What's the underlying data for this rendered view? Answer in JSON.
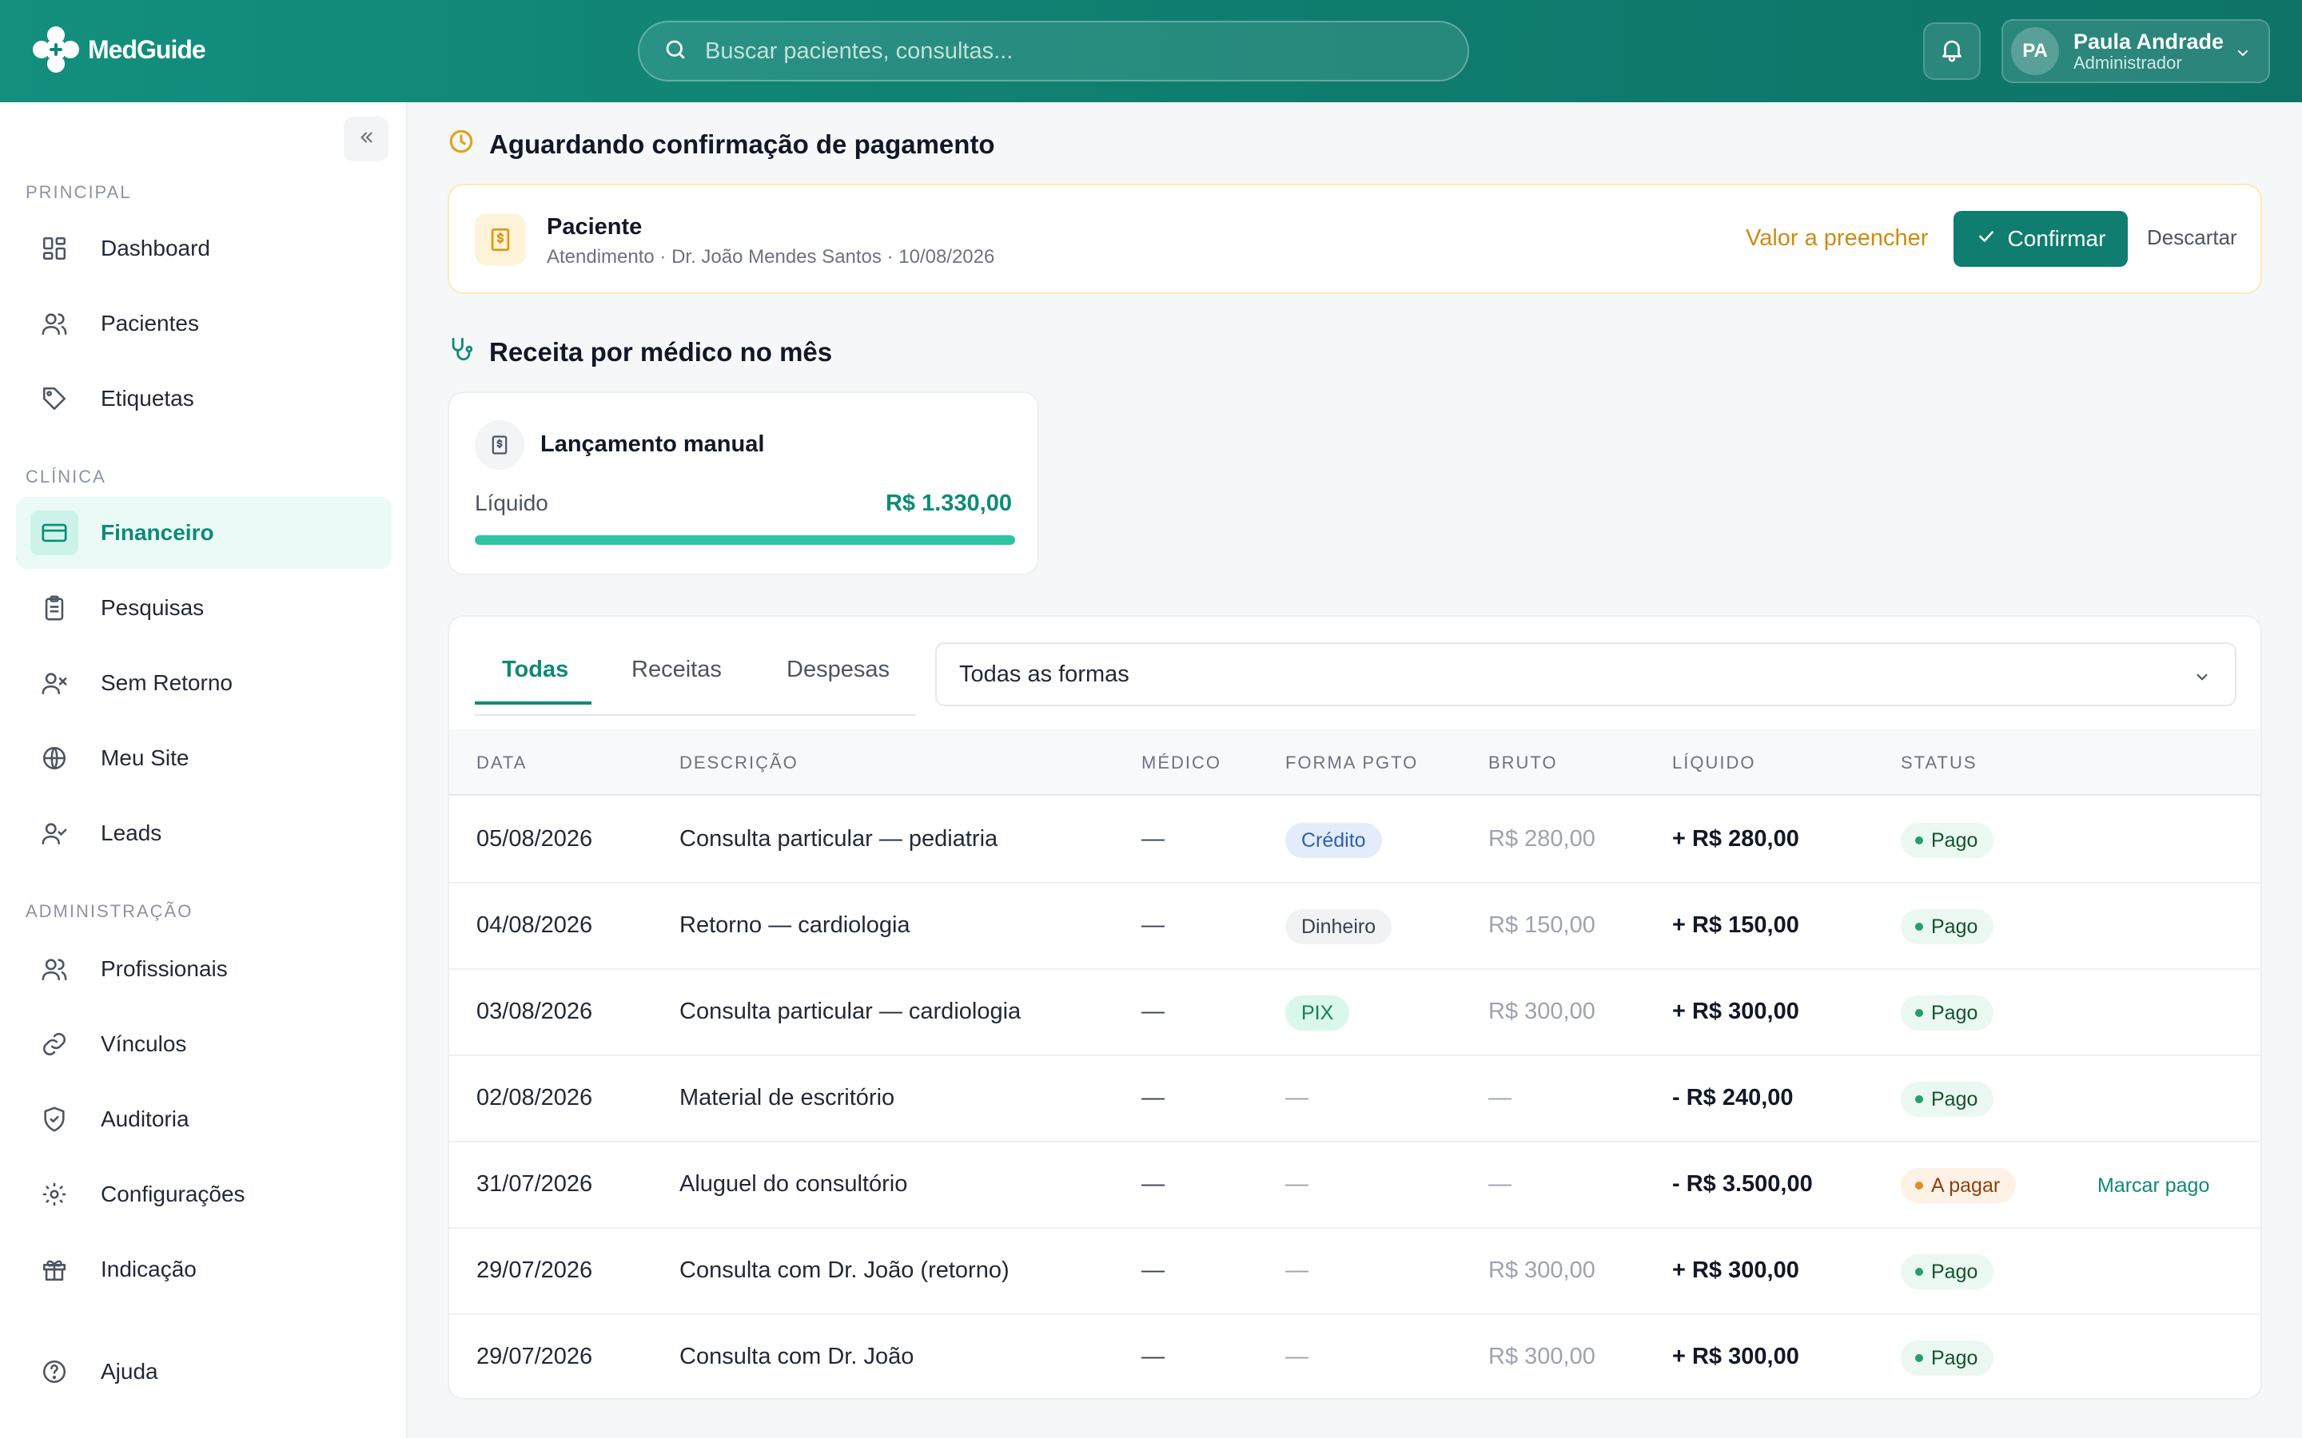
{
  "brand": {
    "name": "MedGuide"
  },
  "search": {
    "placeholder": "Buscar pacientes, consultas..."
  },
  "user": {
    "initials": "PA",
    "name": "Paula Andrade",
    "role": "Administrador"
  },
  "colors": {
    "primary": "#0f7d6f",
    "accent": "#2ec4a6",
    "warning": "#d08a12"
  },
  "sidebar": {
    "sections": {
      "principal": "PRINCIPAL",
      "clinica": "CLÍNICA",
      "administracao": "ADMINISTRAÇÃO"
    },
    "items": {
      "dashboard": "Dashboard",
      "pacientes": "Pacientes",
      "etiquetas": "Etiquetas",
      "financeiro": "Financeiro",
      "pesquisas": "Pesquisas",
      "sem_retorno": "Sem Retorno",
      "meu_site": "Meu Site",
      "leads": "Leads",
      "profissionais": "Profissionais",
      "vinculos": "Vínculos",
      "auditoria": "Auditoria",
      "configuracoes": "Configurações",
      "indicacao": "Indicação",
      "ajuda": "Ajuda"
    },
    "active": "financeiro"
  },
  "pending": {
    "title": "Aguardando confirmação de pagamento",
    "name": "Paciente",
    "subtitle": "Atendimento · Dr. João Mendes Santos · 10/08/2026",
    "value_label": "Valor a preencher",
    "confirm_label": "Confirmar",
    "discard_label": "Descartar"
  },
  "revenue": {
    "title": "Receita por médico no mês",
    "card": {
      "name": "Lançamento manual",
      "liquid_label": "Líquido",
      "liquid_value": "R$ 1.330,00",
      "progress": 1.0
    }
  },
  "tabs": {
    "all": "Todas",
    "revenues": "Receitas",
    "expenses": "Despesas",
    "active": "all"
  },
  "filter": {
    "selected": "Todas as formas"
  },
  "table": {
    "headers": {
      "date": "DATA",
      "description": "DESCRIÇÃO",
      "doctor": "MÉDICO",
      "payment": "FORMA PGTO",
      "gross": "BRUTO",
      "net": "LÍQUIDO",
      "status": "STATUS"
    },
    "action_label": "Marcar pago",
    "rows": [
      {
        "date": "05/08/2026",
        "description": "Consulta particular — pediatria",
        "doctor": "—",
        "payment": "Crédito",
        "payment_kind": "credito",
        "gross": "R$ 280,00",
        "net": "+ R$ 280,00",
        "status": "Pago",
        "status_kind": "pago"
      },
      {
        "date": "04/08/2026",
        "description": "Retorno — cardiologia",
        "doctor": "—",
        "payment": "Dinheiro",
        "payment_kind": "dinheiro",
        "gross": "R$ 150,00",
        "net": "+ R$ 150,00",
        "status": "Pago",
        "status_kind": "pago"
      },
      {
        "date": "03/08/2026",
        "description": "Consulta particular — cardiologia",
        "doctor": "—",
        "payment": "PIX",
        "payment_kind": "pix",
        "gross": "R$ 300,00",
        "net": "+ R$ 300,00",
        "status": "Pago",
        "status_kind": "pago"
      },
      {
        "date": "02/08/2026",
        "description": "Material de escritório",
        "doctor": "—",
        "payment": "—",
        "payment_kind": "none",
        "gross": "—",
        "net": "- R$ 240,00",
        "status": "Pago",
        "status_kind": "pago"
      },
      {
        "date": "31/07/2026",
        "description": "Aluguel do consultório",
        "doctor": "—",
        "payment": "—",
        "payment_kind": "none",
        "gross": "—",
        "net": "- R$ 3.500,00",
        "status": "A pagar",
        "status_kind": "apagar"
      },
      {
        "date": "29/07/2026",
        "description": "Consulta com Dr. João (retorno)",
        "doctor": "—",
        "payment": "—",
        "payment_kind": "none",
        "gross": "R$ 300,00",
        "net": "+ R$ 300,00",
        "status": "Pago",
        "status_kind": "pago"
      },
      {
        "date": "29/07/2026",
        "description": "Consulta com Dr. João",
        "doctor": "—",
        "payment": "—",
        "payment_kind": "none",
        "gross": "R$ 300,00",
        "net": "+ R$ 300,00",
        "status": "Pago",
        "status_kind": "pago"
      }
    ]
  }
}
